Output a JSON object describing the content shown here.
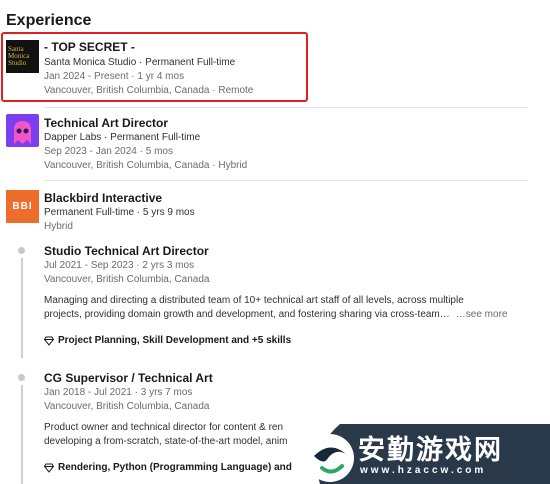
{
  "section": {
    "title": "Experience"
  },
  "experiences": [
    {
      "title": "- TOP SECRET -",
      "company_type": "Santa Monica Studio · Permanent Full-time",
      "dates": "Jan 2024 - Present · 1 yr 4 mos",
      "location": "Vancouver, British Columbia, Canada · Remote",
      "logo_text_1": "Santa",
      "logo_text_2": "Monica",
      "logo_text_3": "Studio",
      "logo_bg": "#111111",
      "logo_fg": "#d9b24a"
    },
    {
      "title": "Technical Art Director",
      "company_type": "Dapper Labs · Permanent Full-time",
      "dates": "Sep 2023 - Jan 2024 · 5 mos",
      "location": "Vancouver, British Columbia, Canada · Hybrid",
      "logo_bg": "#7a3ff0"
    },
    {
      "company": "Blackbird Interactive",
      "summary": "Permanent Full-time · 5 yrs 9 mos",
      "work_mode": "Hybrid",
      "logo_text": "BBI",
      "logo_bg": "#ee6d2b",
      "roles": [
        {
          "title": "Studio Technical Art Director",
          "dates": "Jul 2021 - Sep 2023 · 2 yrs 3 mos",
          "location": "Vancouver, British Columbia, Canada",
          "description_1": "Managing and directing a distributed team of 10+ technical art staff of all levels, across multiple",
          "description_2": "projects, providing domain growth and development, and fostering sharing via cross-team…",
          "see_more": "…see more",
          "skills": "Project Planning, Skill Development and +5 skills"
        },
        {
          "title": "CG Supervisor / Technical Art",
          "dates": "Jan 2018 - Jul 2021 · 3 yrs 7 mos",
          "location": "Vancouver, British Columbia, Canada",
          "description_1": "Product owner and technical director for content & ren",
          "description_2": "developing a from-scratch, state-of-the-art model, anim",
          "skills": "Rendering, Python (Programming Language) and"
        }
      ]
    }
  ],
  "watermark": {
    "title": "安勤游戏网",
    "url": "www.hzaccw.com"
  },
  "colors": {
    "highlight": "#e02020",
    "watermark_bg": "#17283b"
  }
}
